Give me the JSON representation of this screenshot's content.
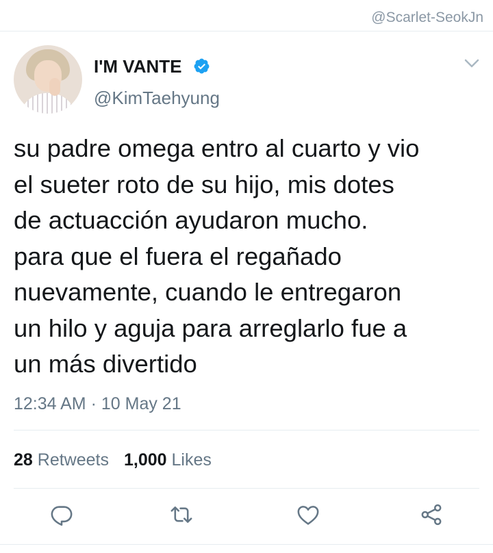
{
  "watermark": "@Scarlet-SeokJn",
  "author": {
    "display_name": "I'M VANTE",
    "handle": "@KimTaehyung",
    "verified": true
  },
  "tweet": {
    "text_lines": [
      "su padre omega entro al cuarto y vio",
      "el sueter roto de su hijo, mis dotes",
      "de actuacción ayudaron mucho.",
      "para que el fuera el regañado",
      "nuevamente, cuando le entregaron",
      "un hilo y aguja para arreglarlo fue a",
      "un más divertido"
    ],
    "time": "12:34 AM",
    "separator": "·",
    "date": "10 May 21"
  },
  "stats": {
    "retweets_count": "28",
    "retweets_label": "Retweets",
    "likes_count": "1,000",
    "likes_label": "Likes"
  },
  "actions": [
    "reply-icon",
    "retweet-icon",
    "like-icon",
    "share-icon"
  ],
  "colors": {
    "text": "#14171a",
    "secondary": "#657786",
    "verified": "#1da1f2",
    "divider": "#e6ecf0"
  }
}
